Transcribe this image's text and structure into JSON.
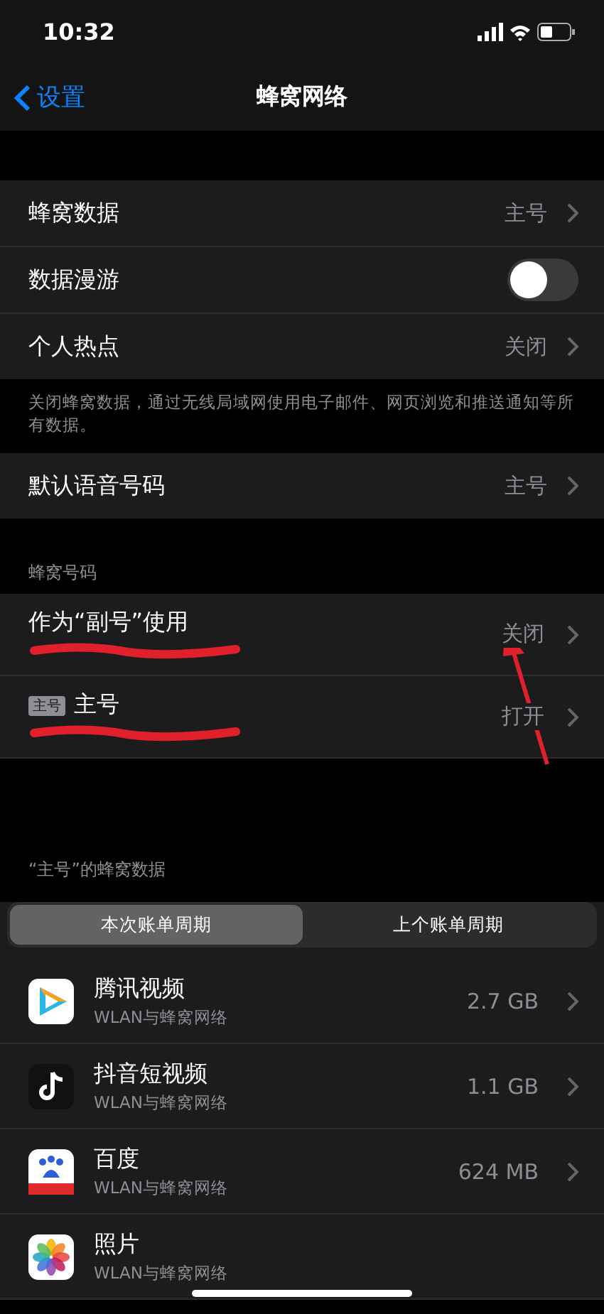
{
  "status_bar": {
    "time": "10:32"
  },
  "nav": {
    "back": "设置",
    "title": "蜂窝网络"
  },
  "group_1": [
    {
      "kind": "value",
      "label": "蜂窝数据",
      "value": "主号"
    },
    {
      "kind": "toggle",
      "label": "数据漫游",
      "on": false
    },
    {
      "kind": "value",
      "label": "个人热点",
      "value": "关闭"
    }
  ],
  "group_1_footer": "关闭蜂窝数据，通过无线局域网使用电子邮件、网页浏览和推送通知等所有数据。",
  "group_2": [
    {
      "kind": "value",
      "label": "默认语音号码",
      "value": "主号"
    }
  ],
  "sim_header": "蜂窝号码",
  "sims": [
    {
      "label": "作为“副号”使用",
      "value": "关闭"
    },
    {
      "badge": "主号",
      "label": "主号",
      "value": "打开"
    }
  ],
  "usage_header": "“主号”的蜂窝数据",
  "segments": [
    {
      "label": "本次账单周期",
      "selected": true
    },
    {
      "label": "上个账单周期",
      "selected": false
    }
  ],
  "apps": [
    {
      "kind": "video",
      "name": "腾讯视频",
      "sub": "WLAN与蜂窝网络",
      "usage": "2.7 GB"
    },
    {
      "kind": "note",
      "name": "抖音短视频",
      "sub": "WLAN与蜂窝网络",
      "usage": "1.1 GB"
    },
    {
      "kind": "paw",
      "name": "百度",
      "sub": "WLAN与蜂窝网络",
      "usage": "624 MB"
    },
    {
      "kind": "flower",
      "name": "照片",
      "sub": "WLAN与蜂窝网络"
    }
  ]
}
